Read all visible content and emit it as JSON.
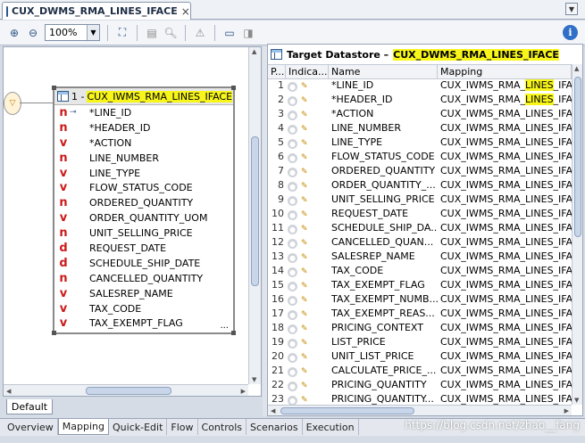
{
  "editor_tab": {
    "label": "CUX_DWMS_RMA_LINES_IFACE",
    "close": "×"
  },
  "toolbar": {
    "zoom_value": "100%"
  },
  "datastore": {
    "title_prefix": "1 -",
    "title": "CUX_IWMS_RMA_LINES_IFACE",
    "columns": [
      {
        "type": "n",
        "key": true,
        "name": "*LINE_ID"
      },
      {
        "type": "n",
        "key": false,
        "name": "*HEADER_ID"
      },
      {
        "type": "v",
        "key": false,
        "name": "*ACTION"
      },
      {
        "type": "n",
        "key": false,
        "name": "LINE_NUMBER"
      },
      {
        "type": "v",
        "key": false,
        "name": "LINE_TYPE"
      },
      {
        "type": "v",
        "key": false,
        "name": "FLOW_STATUS_CODE"
      },
      {
        "type": "n",
        "key": false,
        "name": "ORDERED_QUANTITY"
      },
      {
        "type": "v",
        "key": false,
        "name": "ORDER_QUANTITY_UOM"
      },
      {
        "type": "n",
        "key": false,
        "name": "UNIT_SELLING_PRICE"
      },
      {
        "type": "d",
        "key": false,
        "name": "REQUEST_DATE"
      },
      {
        "type": "d",
        "key": false,
        "name": "SCHEDULE_SHIP_DATE"
      },
      {
        "type": "n",
        "key": false,
        "name": "CANCELLED_QUANTITY"
      },
      {
        "type": "v",
        "key": false,
        "name": "SALESREP_NAME"
      },
      {
        "type": "v",
        "key": false,
        "name": "TAX_CODE"
      },
      {
        "type": "v",
        "key": false,
        "name": "TAX_EXEMPT_FLAG"
      }
    ],
    "more": "..."
  },
  "default_tab": "Default",
  "target": {
    "label": "Target Datastore –",
    "name": "CUX_DWMS_RMA_LINES_IFACE",
    "headers": [
      "P...",
      "Indica...",
      "Name",
      "Mapping"
    ],
    "rows": [
      {
        "n": "1",
        "name": "*LINE_ID",
        "map_pre": "CUX_IWMS_RMA_",
        "map_hl": "LINES",
        "map_post": "_IFA"
      },
      {
        "n": "2",
        "name": "*HEADER_ID",
        "map_pre": "CUX_IWMS_RMA_",
        "map_hl": "LINES",
        "map_post": "_IFA"
      },
      {
        "n": "3",
        "name": "*ACTION",
        "map_pre": "CUX_IWMS_RMA_LINES_IFA",
        "map_hl": "",
        "map_post": ""
      },
      {
        "n": "4",
        "name": "LINE_NUMBER",
        "map_pre": "CUX_IWMS_RMA_LINES_IFA",
        "map_hl": "",
        "map_post": ""
      },
      {
        "n": "5",
        "name": "LINE_TYPE",
        "map_pre": "CUX_IWMS_RMA_LINES_IFA",
        "map_hl": "",
        "map_post": ""
      },
      {
        "n": "6",
        "name": "FLOW_STATUS_CODE",
        "map_pre": "CUX_IWMS_RMA_LINES_IFA",
        "map_hl": "",
        "map_post": ""
      },
      {
        "n": "7",
        "name": "ORDERED_QUANTITY",
        "map_pre": "CUX_IWMS_RMA_LINES_IFA",
        "map_hl": "",
        "map_post": ""
      },
      {
        "n": "8",
        "name": "ORDER_QUANTITY_...",
        "map_pre": "CUX_IWMS_RMA_LINES_IFA",
        "map_hl": "",
        "map_post": ""
      },
      {
        "n": "9",
        "name": "UNIT_SELLING_PRICE",
        "map_pre": "CUX_IWMS_RMA_LINES_IFA",
        "map_hl": "",
        "map_post": ""
      },
      {
        "n": "10",
        "name": "REQUEST_DATE",
        "map_pre": "CUX_IWMS_RMA_LINES_IFA",
        "map_hl": "",
        "map_post": ""
      },
      {
        "n": "11",
        "name": "SCHEDULE_SHIP_DA...",
        "map_pre": "CUX_IWMS_RMA_LINES_IFA",
        "map_hl": "",
        "map_post": ""
      },
      {
        "n": "12",
        "name": "CANCELLED_QUAN...",
        "map_pre": "CUX_IWMS_RMA_LINES_IFA",
        "map_hl": "",
        "map_post": ""
      },
      {
        "n": "13",
        "name": "SALESREP_NAME",
        "map_pre": "CUX_IWMS_RMA_LINES_IFA",
        "map_hl": "",
        "map_post": ""
      },
      {
        "n": "14",
        "name": "TAX_CODE",
        "map_pre": "CUX_IWMS_RMA_LINES_IFA",
        "map_hl": "",
        "map_post": ""
      },
      {
        "n": "15",
        "name": "TAX_EXEMPT_FLAG",
        "map_pre": "CUX_IWMS_RMA_LINES_IFA",
        "map_hl": "",
        "map_post": ""
      },
      {
        "n": "16",
        "name": "TAX_EXEMPT_NUMB...",
        "map_pre": "CUX_IWMS_RMA_LINES_IFA",
        "map_hl": "",
        "map_post": ""
      },
      {
        "n": "17",
        "name": "TAX_EXEMPT_REAS...",
        "map_pre": "CUX_IWMS_RMA_LINES_IFA",
        "map_hl": "",
        "map_post": ""
      },
      {
        "n": "18",
        "name": "PRICING_CONTEXT",
        "map_pre": "CUX_IWMS_RMA_LINES_IFA",
        "map_hl": "",
        "map_post": ""
      },
      {
        "n": "19",
        "name": "LIST_PRICE",
        "map_pre": "CUX_IWMS_RMA_LINES_IFA",
        "map_hl": "",
        "map_post": ""
      },
      {
        "n": "20",
        "name": "UNIT_LIST_PRICE",
        "map_pre": "CUX_IWMS_RMA_LINES_IFA",
        "map_hl": "",
        "map_post": ""
      },
      {
        "n": "21",
        "name": "CALCULATE_PRICE_...",
        "map_pre": "CUX_IWMS_RMA_LINES_IFA",
        "map_hl": "",
        "map_post": ""
      },
      {
        "n": "22",
        "name": "PRICING_QUANTITY",
        "map_pre": "CUX_IWMS_RMA_LINES_IFA",
        "map_hl": "",
        "map_post": ""
      },
      {
        "n": "23",
        "name": "PRICING_QUANTITY...",
        "map_pre": "CUX_IWMS_RMA_LINES_IFA",
        "map_hl": "",
        "map_post": ""
      }
    ]
  },
  "bottom_tabs": [
    "Overview",
    "Mapping",
    "Quick-Edit",
    "Flow",
    "Controls",
    "Scenarios",
    "Execution"
  ],
  "active_bottom_tab": "Mapping",
  "watermark": "https://blog.csdn.net/zhao__fang",
  "colors": {
    "highlight": "#f7f51a",
    "type_letter": "#cc1a1a",
    "accent": "#2f6fc7"
  }
}
